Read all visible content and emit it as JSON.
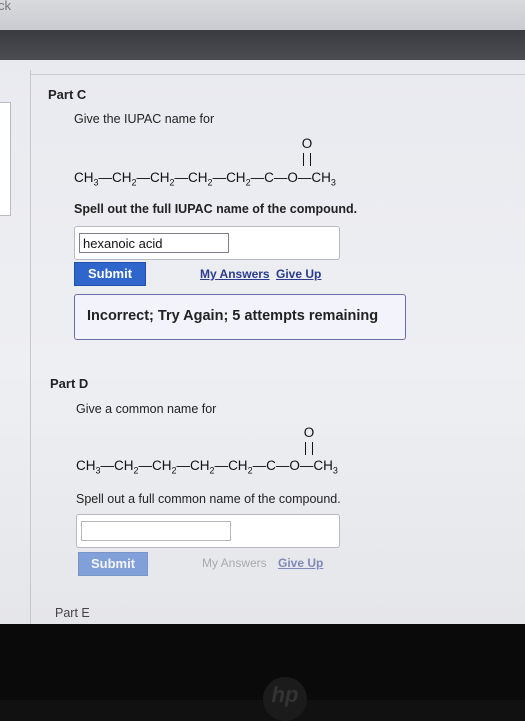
{
  "browser": {
    "tab_fragment": "ck"
  },
  "part_c": {
    "title": "Part C",
    "prompt": "Give the IUPAC name for",
    "formula": {
      "ch3a": "CH",
      "s3a": "3",
      "ch2": "CH",
      "s2": "2",
      "carbon": "C",
      "oxygen": "O",
      "carbonyl_o": "O",
      "dash": "—"
    },
    "instruction": "Spell out the full IUPAC name of the compound.",
    "answer_value": "hexanoic acid",
    "submit_label": "Submit",
    "my_answers_label": "My Answers",
    "give_up_label": "Give Up",
    "feedback": "Incorrect; Try Again; 5 attempts remaining"
  },
  "part_d": {
    "title": "Part D",
    "prompt": "Give a common name for",
    "instruction": "Spell out a full common name of the compound.",
    "answer_value": "",
    "submit_label": "Submit",
    "my_answers_label": "My Answers",
    "give_up_label": "Give Up"
  },
  "part_e": {
    "title": "Part E"
  },
  "device": {
    "logo": "hp"
  }
}
